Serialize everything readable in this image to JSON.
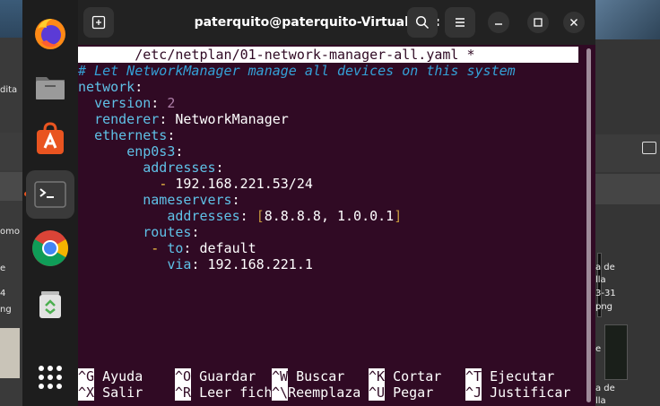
{
  "desktop": {
    "left_texts": [
      "dita",
      "omo",
      "e",
      "4",
      "ng"
    ],
    "right_texts": [
      "a de",
      "lla",
      "3-31",
      "png",
      "e",
      "a de",
      "lla"
    ]
  },
  "dock": {
    "items": [
      {
        "name": "firefox-icon",
        "active": false
      },
      {
        "name": "files-icon",
        "active": false
      },
      {
        "name": "app-center-icon",
        "active": false
      },
      {
        "name": "terminal-icon",
        "active": true
      },
      {
        "name": "chrome-icon",
        "active": false
      },
      {
        "name": "trash-icon",
        "active": false
      },
      {
        "name": "show-apps-icon",
        "active": false
      }
    ]
  },
  "window": {
    "title": "paterquito@paterquito-VirtualBox: ~"
  },
  "nano": {
    "file_header": "/etc/netplan/01-network-manager-all.yaml *",
    "comment": "# Let NetworkManager manage all devices on this system",
    "k_network": "network",
    "k_version": "version",
    "v_version": "2",
    "k_renderer": "renderer",
    "v_renderer": "NetworkManager",
    "k_ethernets": "ethernets",
    "k_iface": "enp0s3",
    "k_addresses": "addresses",
    "v_address": "192.168.221.53/24",
    "k_nameservers": "nameservers",
    "k_ns_addresses": "addresses",
    "v_ns_1": "8.8.8.8",
    "v_ns_2": "1.0.0.1",
    "k_routes": "routes",
    "k_to": "to",
    "v_to": "default",
    "k_via": "via",
    "v_via": "192.168.221.1",
    "shortcuts_row1": [
      {
        "key": "^G",
        "label": "Ayuda"
      },
      {
        "key": "^O",
        "label": "Guardar"
      },
      {
        "key": "^W",
        "label": "Buscar"
      },
      {
        "key": "^K",
        "label": "Cortar"
      },
      {
        "key": "^T",
        "label": "Ejecutar"
      }
    ],
    "shortcuts_row2": [
      {
        "key": "^X",
        "label": "Salir"
      },
      {
        "key": "^R",
        "label": "Leer fich"
      },
      {
        "key": "^\\",
        "label": "Reemplaza"
      },
      {
        "key": "^U",
        "label": "Pegar"
      },
      {
        "key": "^J",
        "label": "Justificar"
      }
    ]
  }
}
